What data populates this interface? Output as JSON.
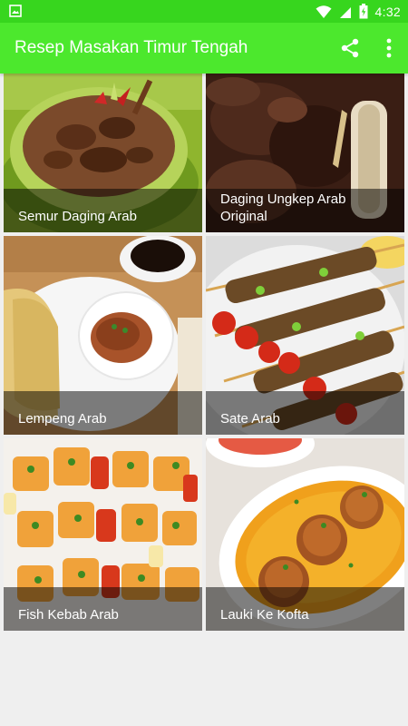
{
  "status_bar": {
    "time": "4:32",
    "icons": [
      "image-notification-icon",
      "wifi-icon",
      "signal-icon",
      "battery-icon"
    ]
  },
  "toolbar": {
    "title": "Resep Masakan Timur Tengah",
    "share_icon": "share-icon",
    "more_icon": "more-vert-icon"
  },
  "colors": {
    "status_bar": "#37d61e",
    "toolbar": "#4ce82d",
    "background": "#efefef"
  },
  "recipes": [
    {
      "label": "Semur Daging Arab"
    },
    {
      "label": "Daging Ungkep Arab Original"
    },
    {
      "label": "Lempeng Arab"
    },
    {
      "label": "Sate Arab"
    },
    {
      "label": "Fish Kebab Arab"
    },
    {
      "label": "Lauki Ke Kofta"
    }
  ]
}
